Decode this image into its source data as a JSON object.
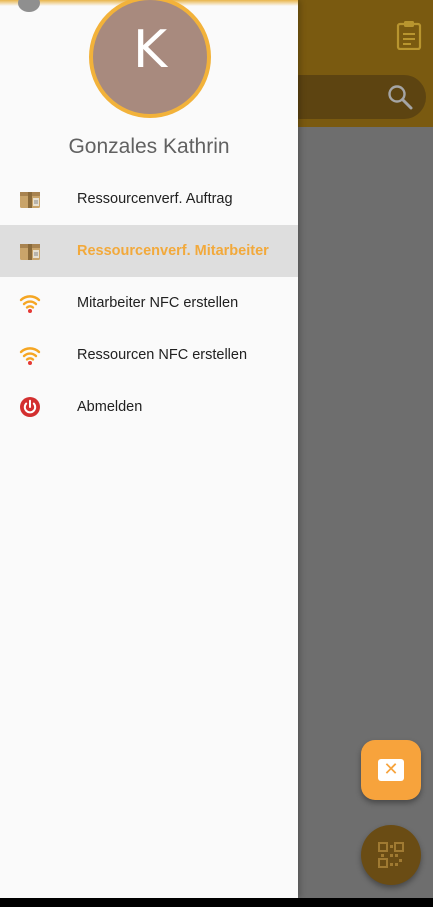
{
  "drawer": {
    "avatar_letter": "K",
    "profile_name": "Gonzales Kathrin",
    "items": [
      {
        "label": "Ressourcenverf. Auftrag",
        "icon": "resource-box-icon",
        "active": false
      },
      {
        "label": "Ressourcenverf. Mitarbeiter",
        "icon": "resource-box-icon",
        "active": true
      },
      {
        "label": "Mitarbeiter NFC erstellen",
        "icon": "nfc-wifi-icon",
        "active": false
      },
      {
        "label": "Ressourcen NFC erstellen",
        "icon": "nfc-wifi-icon",
        "active": false
      },
      {
        "label": "Abmelden",
        "icon": "power-icon",
        "active": false
      }
    ]
  },
  "colors": {
    "accent": "#f2a93b",
    "avatar_background": "#a88a7e",
    "active_item_background": "#dedede",
    "logout_red": "#d32f2f"
  },
  "background": {
    "icons": [
      "clipboard-icon",
      "search-icon",
      "close-icon",
      "qr-code-icon"
    ]
  }
}
